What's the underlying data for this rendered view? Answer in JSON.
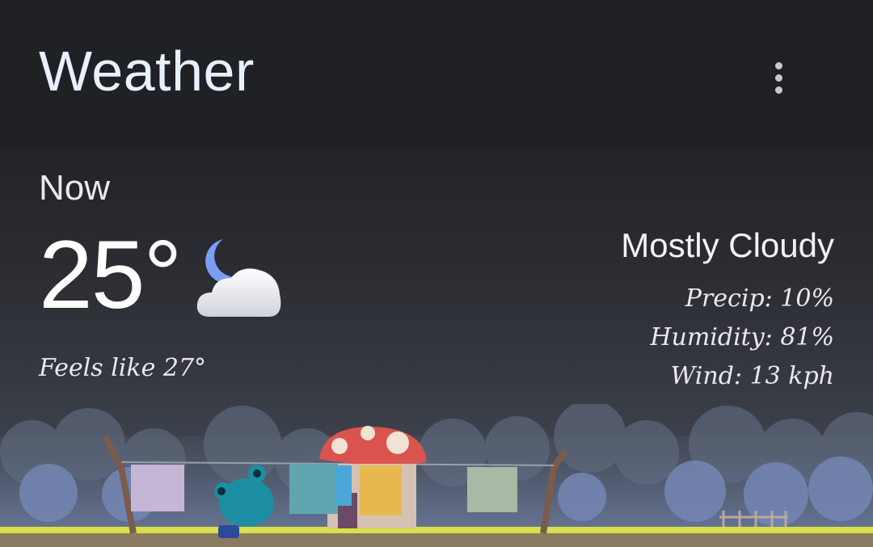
{
  "app": {
    "title": "Weather",
    "menu_icon": "more-vert-icon"
  },
  "current": {
    "label": "Now",
    "temperature": "25°",
    "icon": "partly-cloudy-night-icon",
    "feels_like": "Feels like 27°",
    "condition": "Mostly Cloudy",
    "precip": "Precip: 10%",
    "humidity": "Humidity: 81%",
    "wind": "Wind: 13 kph"
  },
  "colors": {
    "background": "#202124",
    "text": "#e8eaed",
    "moon": "#7b9ef5"
  }
}
